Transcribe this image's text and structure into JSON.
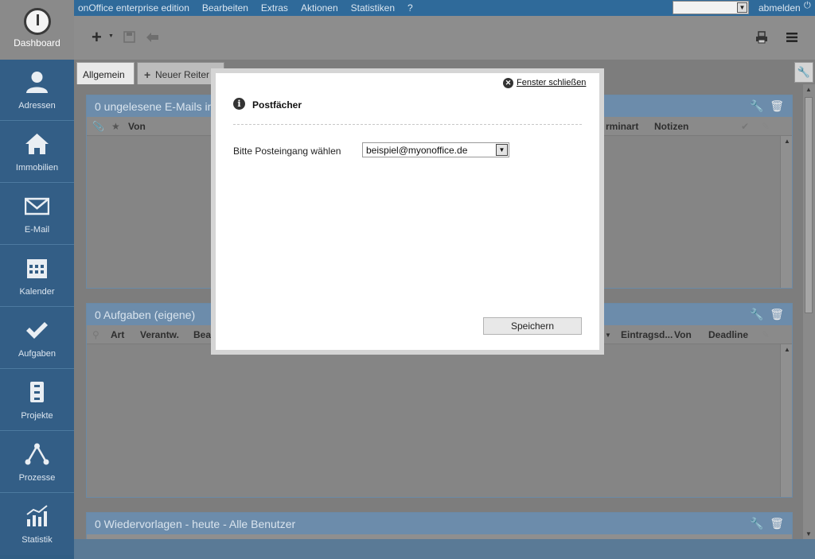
{
  "menu": {
    "items": [
      "onOffice enterprise edition",
      "Bearbeiten",
      "Extras",
      "Aktionen",
      "Statistiken",
      "?"
    ],
    "select_value": "",
    "logout": "abmelden"
  },
  "sidebar": {
    "dashboard": "Dashboard",
    "items": [
      {
        "label": "Adressen",
        "icon": "person-icon"
      },
      {
        "label": "Immobilien",
        "icon": "house-icon"
      },
      {
        "label": "E-Mail",
        "icon": "envelope-icon"
      },
      {
        "label": "Kalender",
        "icon": "calendar-icon"
      },
      {
        "label": "Aufgaben",
        "icon": "checkmark-icon"
      },
      {
        "label": "Projekte",
        "icon": "cabinet-icon"
      },
      {
        "label": "Prozesse",
        "icon": "process-icon"
      },
      {
        "label": "Statistik",
        "icon": "chart-icon"
      }
    ]
  },
  "tabs": {
    "active": "Allgemein",
    "new": "Neuer Reiter"
  },
  "widgets": {
    "emails": {
      "title": "0 ungelesene E-Mails in",
      "col_from": "Von",
      "col_type": "rminart",
      "col_notes": "Notizen"
    },
    "tasks": {
      "title": "0 Aufgaben (eigene)",
      "col_art": "Art",
      "col_resp": "Verantw.",
      "col_bea": "Bea",
      "col_entry": "Eintragsd...",
      "col_from": "Von",
      "col_deadline": "Deadline"
    },
    "followups": {
      "title": "0 Wiedervorlagen - heute - Alle Benutzer"
    }
  },
  "modal": {
    "close": "Fenster schließen",
    "title": "Postfächer",
    "label": "Bitte Posteingang wählen",
    "selected": "beispiel@myonoffice.de",
    "save": "Speichern"
  }
}
